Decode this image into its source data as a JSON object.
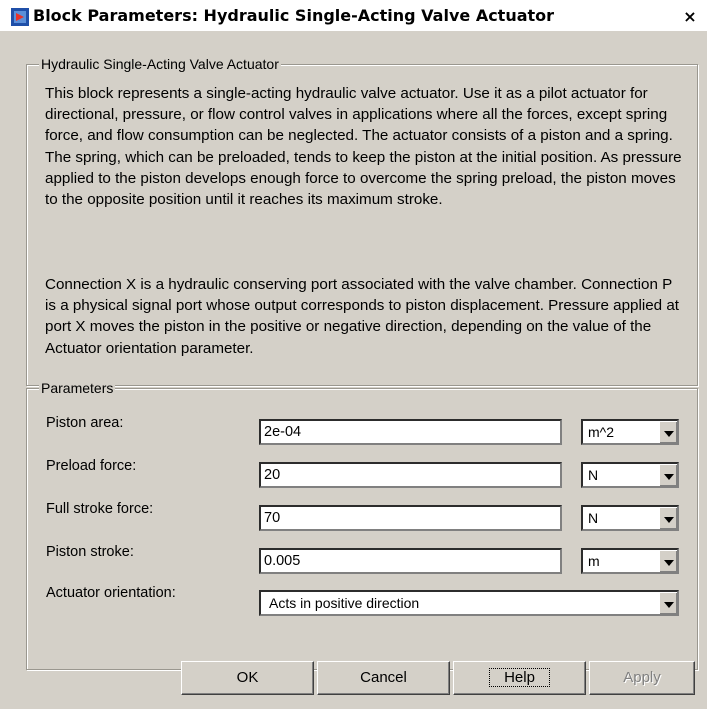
{
  "window": {
    "title": "Block Parameters: Hydraulic Single-Acting Valve Actuator",
    "close_glyph": "×",
    "icon": "simulink-block-icon"
  },
  "description": {
    "group_title": "Hydraulic Single-Acting Valve Actuator",
    "paragraph1": "This block represents a single-acting hydraulic valve actuator. Use it as a pilot actuator for directional, pressure, or flow control valves in applications where all the forces, except spring force, and flow consumption can be neglected. The actuator consists of a piston and a spring. The spring, which can be preloaded, tends to keep the piston at the initial position. As pressure applied to the piston develops enough force to overcome the spring preload, the piston moves to the opposite position until it reaches its maximum stroke.",
    "paragraph2": "Connection X is a hydraulic conserving port associated with the valve chamber. Connection P is a physical signal port whose output corresponds to piston displacement. Pressure applied at port X moves the piston in the positive or negative direction, depending on the value of the Actuator orientation parameter."
  },
  "parameters": {
    "group_title": "Parameters",
    "piston_area": {
      "label": "Piston area:",
      "value": "2e-04",
      "unit": "m^2"
    },
    "preload_force": {
      "label": "Preload force:",
      "value": "20",
      "unit": "N"
    },
    "full_stroke_force": {
      "label": "Full stroke force:",
      "value": "70",
      "unit": "N"
    },
    "piston_stroke": {
      "label": "Piston stroke:",
      "value": "0.005",
      "unit": "m"
    },
    "actuator_orientation": {
      "label": "Actuator orientation:",
      "value": "Acts in positive direction"
    }
  },
  "buttons": {
    "ok": "OK",
    "cancel": "Cancel",
    "help": "Help",
    "apply": "Apply"
  }
}
